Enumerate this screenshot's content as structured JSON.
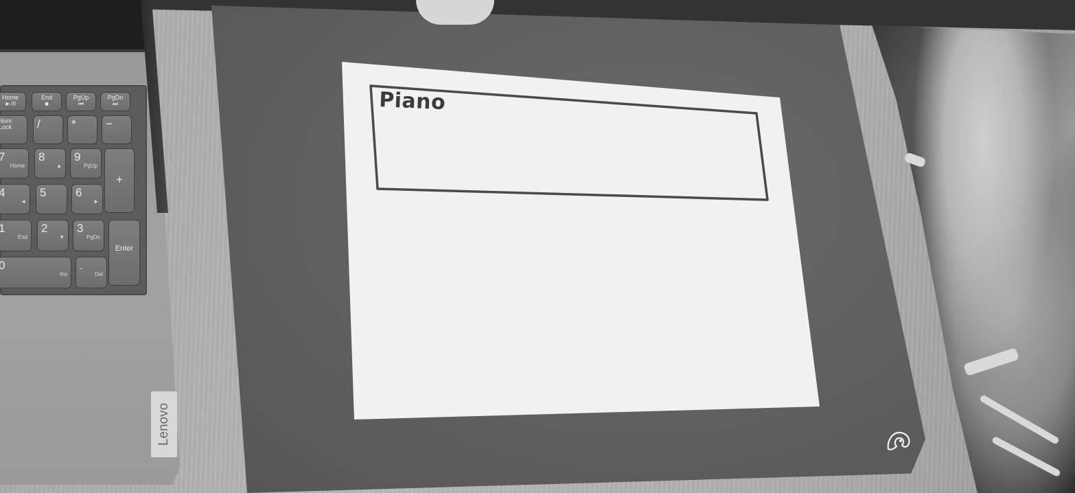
{
  "scene": {
    "sketch_title": "Piano",
    "laptop_brand": "Lenovo"
  },
  "numpad": {
    "keys": [
      {
        "main": "Home",
        "sub": "►/II"
      },
      {
        "main": "End",
        "sub": "■"
      },
      {
        "main": "PgUp",
        "sub": "⏮"
      },
      {
        "main": "PgDn",
        "sub": "⏭"
      },
      {
        "main": "Num Lock",
        "sub": ""
      },
      {
        "main": "/",
        "sub": ""
      },
      {
        "main": "*",
        "sub": ""
      },
      {
        "main": "−",
        "sub": ""
      },
      {
        "main": "7",
        "sub": "Home"
      },
      {
        "main": "8",
        "sub": "▲"
      },
      {
        "main": "9",
        "sub": "PgUp"
      },
      {
        "main": "+",
        "sub": ""
      },
      {
        "main": "4",
        "sub": "◄"
      },
      {
        "main": "5",
        "sub": ""
      },
      {
        "main": "6",
        "sub": "►"
      },
      {
        "main": "1",
        "sub": "End"
      },
      {
        "main": "2",
        "sub": "▼"
      },
      {
        "main": "3",
        "sub": "PgDn"
      },
      {
        "main": "Enter",
        "sub": ""
      },
      {
        "main": "0",
        "sub": "Ins"
      },
      {
        "main": ".",
        "sub": "Del"
      }
    ]
  },
  "colors": {
    "paper": "#f1f1f1",
    "ink": "#3c3c3c",
    "mat": "#5e5e5e",
    "desk": "#b1b1b1"
  }
}
